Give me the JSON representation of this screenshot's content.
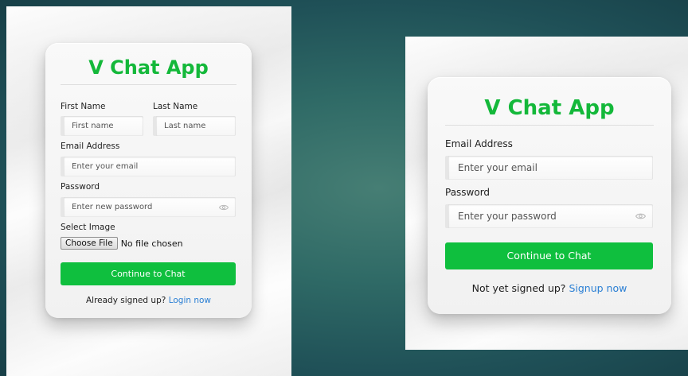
{
  "signup": {
    "app_title": "V Chat App",
    "first_name_label": "First Name",
    "first_name_placeholder": "First name",
    "last_name_label": "Last Name",
    "last_name_placeholder": "Last name",
    "email_label": "Email Address",
    "email_placeholder": "Enter your email",
    "password_label": "Password",
    "password_placeholder": "Enter new password",
    "image_label": "Select Image",
    "file_button_label": "Choose File",
    "file_status": "No file chosen",
    "submit_label": "Continue to Chat",
    "footer_text": "Already signed up?",
    "footer_link": "Login now"
  },
  "login": {
    "app_title": "V Chat App",
    "email_label": "Email Address",
    "email_placeholder": "Enter your email",
    "password_label": "Password",
    "password_placeholder": "Enter your password",
    "submit_label": "Continue to Chat",
    "footer_text": "Not yet signed up?",
    "footer_link": "Signup now"
  },
  "colors": {
    "brand_green": "#14b83a",
    "button_green": "#0fbf3e",
    "link_blue": "#2a7fd4",
    "background_teal": "#2f6a66"
  },
  "icons": {
    "password_toggle": "eye-icon"
  }
}
